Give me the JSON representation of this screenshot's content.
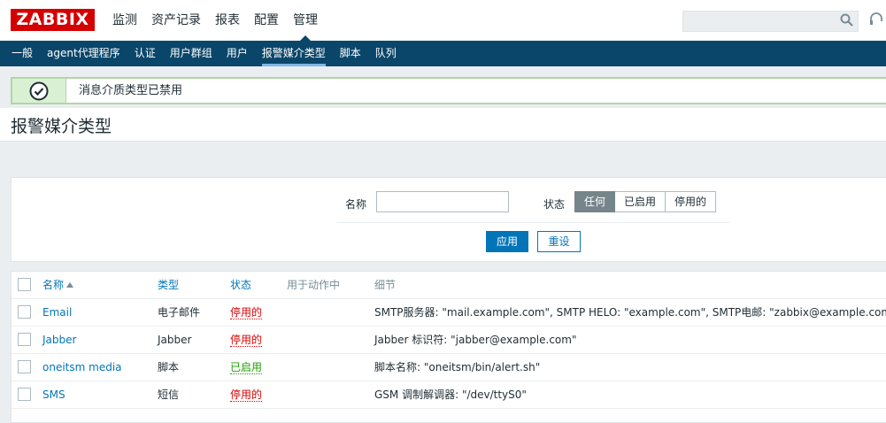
{
  "logo": "ZABBIX",
  "main_menu": [
    "监测",
    "资产记录",
    "报表",
    "配置",
    "管理"
  ],
  "sub_menu": [
    "一般",
    "agent代理程序",
    "认证",
    "用户群组",
    "用户",
    "报警媒介类型",
    "脚本",
    "队列"
  ],
  "message": "消息介质类型已禁用",
  "page_title": "报警媒介类型",
  "filter": {
    "name_label": "名称",
    "name_value": "",
    "status_label": "状态",
    "status_options": [
      "任何",
      "已启用",
      "停用的"
    ],
    "status_selected": "任何",
    "apply": "应用",
    "reset": "重设"
  },
  "table": {
    "headers": {
      "name": "名称",
      "type": "类型",
      "status": "状态",
      "used_in_actions": "用于动作中",
      "details": "细节"
    },
    "rows": [
      {
        "name": "Email",
        "type": "电子邮件",
        "status": "停用的",
        "details": "SMTP服务器: \"mail.example.com\", SMTP HELO: \"example.com\", SMTP电邮: \"zabbix@example.com\""
      },
      {
        "name": "Jabber",
        "type": "Jabber",
        "status": "停用的",
        "details": "Jabber 标识符: \"jabber@example.com\""
      },
      {
        "name": "oneitsm media",
        "type": "脚本",
        "status": "已启用",
        "details": "脚本名称: \"oneitsm/bin/alert.sh\""
      },
      {
        "name": "SMS",
        "type": "短信",
        "status": "停用的",
        "details": "GSM 调制解调器: \"/dev/ttyS0\""
      }
    ]
  },
  "colors": {
    "brand": "#d40000",
    "nav": "#0a466a",
    "link": "#0275b8",
    "disabled": "#dc0000",
    "enabled": "#1d9f00"
  },
  "icons": [
    "search-icon",
    "support-icon",
    "check-circle-icon",
    "sort-asc-icon"
  ]
}
